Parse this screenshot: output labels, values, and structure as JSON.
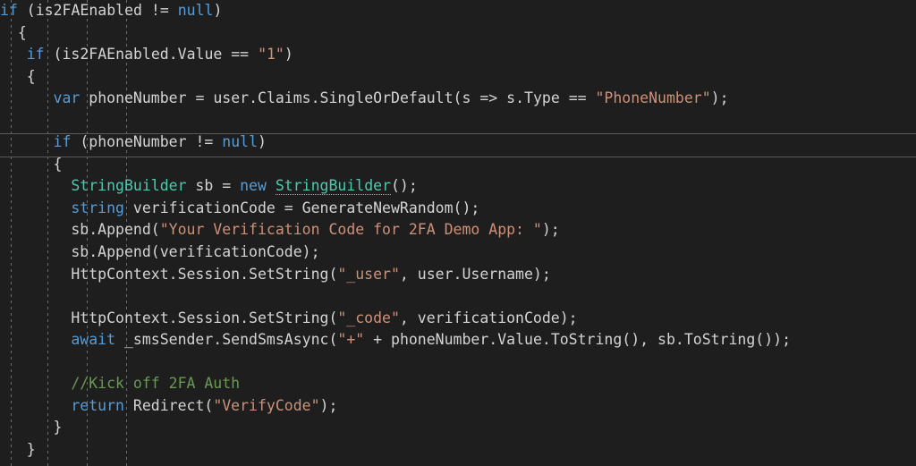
{
  "editor": {
    "name": "code-editor",
    "language": "csharp",
    "theme": "dark",
    "background_color": "#1e1e1e",
    "colors": {
      "keyword": "#569cd6",
      "type": "#4ec9b0",
      "string": "#ce9178",
      "comment": "#6a9955",
      "plain": "#d4d4d4",
      "indent_guide": "#6b6b6b",
      "separator": "#5a5a5a"
    },
    "indent_guides_x": [
      12,
      53,
      97,
      141
    ],
    "separators_y": [
      149,
      175
    ],
    "lines": [
      {
        "indent": 0,
        "tokens": [
          {
            "t": "if",
            "c": "kw"
          },
          {
            "t": " (",
            "c": "pln"
          },
          {
            "t": "is2FAEnabled",
            "c": "pln"
          },
          {
            "t": " != ",
            "c": "pln"
          },
          {
            "t": "null",
            "c": "kw"
          },
          {
            "t": ")",
            "c": "pln"
          }
        ]
      },
      {
        "indent": 2,
        "tokens": [
          {
            "t": "{",
            "c": "brc"
          }
        ]
      },
      {
        "indent": 3,
        "tokens": [
          {
            "t": "if",
            "c": "kw"
          },
          {
            "t": " (",
            "c": "pln"
          },
          {
            "t": "is2FAEnabled.Value",
            "c": "pln"
          },
          {
            "t": " == ",
            "c": "pln"
          },
          {
            "t": "\"1\"",
            "c": "str"
          },
          {
            "t": ")",
            "c": "pln"
          }
        ]
      },
      {
        "indent": 3,
        "tokens": [
          {
            "t": "{",
            "c": "brc"
          }
        ]
      },
      {
        "indent": 6,
        "tokens": [
          {
            "t": "var",
            "c": "kw"
          },
          {
            "t": " phoneNumber = user.Claims.SingleOrDefault(s => s.Type == ",
            "c": "pln"
          },
          {
            "t": "\"PhoneNumber\"",
            "c": "str"
          },
          {
            "t": ");",
            "c": "pln"
          }
        ]
      },
      {
        "indent": 0,
        "tokens": []
      },
      {
        "indent": 6,
        "tokens": [
          {
            "t": "if",
            "c": "kw"
          },
          {
            "t": " (phoneNumber != ",
            "c": "pln"
          },
          {
            "t": "null",
            "c": "kw"
          },
          {
            "t": ")",
            "c": "pln"
          }
        ]
      },
      {
        "indent": 6,
        "tokens": [
          {
            "t": "{",
            "c": "brc"
          }
        ]
      },
      {
        "indent": 8,
        "tokens": [
          {
            "t": "StringBuilder",
            "c": "typ"
          },
          {
            "t": " sb = ",
            "c": "pln"
          },
          {
            "t": "new",
            "c": "kw"
          },
          {
            "t": " ",
            "c": "pln"
          },
          {
            "t": "StringBuilder",
            "c": "typ sugg"
          },
          {
            "t": "();",
            "c": "pln"
          }
        ]
      },
      {
        "indent": 8,
        "tokens": [
          {
            "t": "string",
            "c": "kw"
          },
          {
            "t": " verificationCode = GenerateNewRandom();",
            "c": "pln"
          }
        ]
      },
      {
        "indent": 8,
        "tokens": [
          {
            "t": "sb.Append(",
            "c": "pln"
          },
          {
            "t": "\"Your Verification Code for 2FA Demo App: \"",
            "c": "str"
          },
          {
            "t": ");",
            "c": "pln"
          }
        ]
      },
      {
        "indent": 8,
        "tokens": [
          {
            "t": "sb.Append(verificationCode);",
            "c": "pln"
          }
        ]
      },
      {
        "indent": 8,
        "tokens": [
          {
            "t": "HttpContext.Session.SetString(",
            "c": "pln"
          },
          {
            "t": "\"_user\"",
            "c": "str"
          },
          {
            "t": ", user.Username);",
            "c": "pln"
          }
        ]
      },
      {
        "indent": 0,
        "tokens": []
      },
      {
        "indent": 8,
        "tokens": [
          {
            "t": "HttpContext.Session.SetString(",
            "c": "pln"
          },
          {
            "t": "\"_code\"",
            "c": "str"
          },
          {
            "t": ", verificationCode);",
            "c": "pln"
          }
        ]
      },
      {
        "indent": 8,
        "tokens": [
          {
            "t": "await",
            "c": "kw"
          },
          {
            "t": " _smsSender.SendSmsAsync(",
            "c": "pln"
          },
          {
            "t": "\"+\"",
            "c": "str"
          },
          {
            "t": " + phoneNumber.Value.ToString(), sb.ToString());",
            "c": "pln"
          }
        ]
      },
      {
        "indent": 0,
        "tokens": []
      },
      {
        "indent": 8,
        "tokens": [
          {
            "t": "//Kick off 2FA Auth",
            "c": "cmt"
          }
        ]
      },
      {
        "indent": 8,
        "tokens": [
          {
            "t": "return",
            "c": "kw"
          },
          {
            "t": " Redirect(",
            "c": "pln"
          },
          {
            "t": "\"VerifyCode\"",
            "c": "str"
          },
          {
            "t": ");",
            "c": "pln"
          }
        ]
      },
      {
        "indent": 6,
        "tokens": [
          {
            "t": "}",
            "c": "brc"
          }
        ]
      },
      {
        "indent": 3,
        "tokens": [
          {
            "t": "}",
            "c": "brc"
          }
        ]
      }
    ],
    "plain_text": "if (is2FAEnabled != null)\n    {\n      if (is2FAEnabled.Value == \"1\")\n      {\n            var phoneNumber = user.Claims.SingleOrDefault(s => s.Type == \"PhoneNumber\");\n\n            if (phoneNumber != null)\n            {\n                StringBuilder sb = new StringBuilder();\n                string verificationCode = GenerateNewRandom();\n                sb.Append(\"Your Verification Code for 2FA Demo App: \");\n                sb.Append(verificationCode);\n                HttpContext.Session.SetString(\"_user\", user.Username);\n\n                HttpContext.Session.SetString(\"_code\", verificationCode);\n                await _smsSender.SendSmsAsync(\"+\" + phoneNumber.Value.ToString(), sb.ToString());\n\n                //Kick off 2FA Auth\n                return Redirect(\"VerifyCode\");\n            }\n      }"
  }
}
